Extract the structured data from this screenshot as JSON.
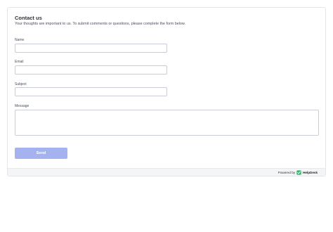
{
  "form": {
    "title": "Contact us",
    "subtitle": "Your thoughts are important to us. To submit comments or questions, please complete the form below.",
    "fields": {
      "name": {
        "label": "Name",
        "value": "",
        "placeholder": ""
      },
      "email": {
        "label": "Email",
        "value": "",
        "placeholder": ""
      },
      "subject": {
        "label": "Subject",
        "value": "",
        "placeholder": ""
      },
      "message": {
        "label": "Message",
        "value": "",
        "placeholder": ""
      }
    },
    "send_label": "Send"
  },
  "footer": {
    "powered_by": "Powered by",
    "brand": "HelpDesk",
    "brand_icon": "helpdesk-check-icon",
    "brand_color": "#2fb56a"
  },
  "colors": {
    "button": "#a4b2ef",
    "border": "#c8ccd4",
    "footer_bg": "#f4f5f7"
  }
}
